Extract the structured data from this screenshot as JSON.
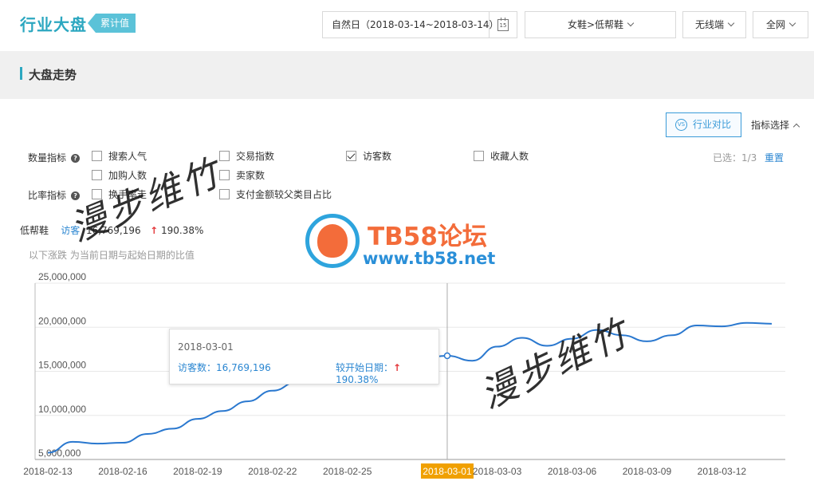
{
  "header": {
    "title": "行业大盘",
    "badge": "累计值",
    "date_range": "自然日（2018-03-14~2018-03-14）",
    "calendar_day": "15",
    "category": "女鞋>低帮鞋",
    "device": "无线端",
    "network": "全网"
  },
  "section": {
    "title": "大盘走势"
  },
  "toolbar": {
    "vs_icon_text": "VS",
    "compare_label": "行业对比",
    "metric_select_label": "指标选择"
  },
  "metrics": {
    "quantity_label": "数量指标",
    "rate_label": "比率指标",
    "help_glyph": "?",
    "items": [
      {
        "label": "搜索人气",
        "checked": false
      },
      {
        "label": "交易指数",
        "checked": false
      },
      {
        "label": "访客数",
        "checked": true
      },
      {
        "label": "收藏人数",
        "checked": false
      },
      {
        "label": "加购人数",
        "checked": false
      },
      {
        "label": "卖家数",
        "checked": false
      },
      {
        "label": "换手率走",
        "checked": false
      },
      {
        "label": "支付金额较父类目占比",
        "checked": false
      }
    ],
    "selected_info": "已选：1/3",
    "reset_label": "重置"
  },
  "summary": {
    "category": "低帮鞋",
    "metric": "访客",
    "value": "16,769,196",
    "change_arrow": "↑",
    "change": "190.38%",
    "note": "以下涨跌  为当前日期与起始日期的比值"
  },
  "tooltip": {
    "date": "2018-03-01",
    "value_label": "访客数：",
    "value": "16,769,196",
    "compare_label": "较开始日期：",
    "compare_arrow": "↑",
    "compare_value": "190.38%"
  },
  "watermark": {
    "title": "TB58论坛",
    "url": "www.tb58.net",
    "signature": "漫步维竹"
  },
  "chart_data": {
    "type": "line",
    "series": [
      {
        "name": "访客数",
        "color": "#2a78cf",
        "x": [
          "2018-02-13",
          "2018-02-14",
          "2018-02-15",
          "2018-02-16",
          "2018-02-17",
          "2018-02-18",
          "2018-02-19",
          "2018-02-20",
          "2018-02-21",
          "2018-02-22",
          "2018-02-23",
          "2018-02-24",
          "2018-02-25",
          "2018-02-26",
          "2018-02-27",
          "2018-02-28",
          "2018-03-01",
          "2018-03-02",
          "2018-03-03",
          "2018-03-04",
          "2018-03-05",
          "2018-03-06",
          "2018-03-07",
          "2018-03-08",
          "2018-03-09",
          "2018-03-10",
          "2018-03-11",
          "2018-03-12",
          "2018-03-13",
          "2018-03-14"
        ],
        "values": [
          5770000,
          7000000,
          6800000,
          6900000,
          7900000,
          8500000,
          9600000,
          10500000,
          11600000,
          12800000,
          13800000,
          14700000,
          15400000,
          15800000,
          16300000,
          16500000,
          16769196,
          16200000,
          17800000,
          18800000,
          17900000,
          18700000,
          19700000,
          19100000,
          18400000,
          19100000,
          20200000,
          20100000,
          20500000,
          20400000
        ]
      }
    ],
    "ylim": [
      5000000,
      25000000
    ],
    "yticks": [
      "5,000,000",
      "10,000,000",
      "15,000,000",
      "20,000,000",
      "25,000,000"
    ],
    "ytick_values": [
      5000000,
      10000000,
      15000000,
      20000000,
      25000000
    ],
    "xticks": [
      "2018-02-13",
      "2018-02-16",
      "2018-02-19",
      "2018-02-22",
      "2018-02-25",
      "2018-03-01",
      "2018-03-03",
      "2018-03-06",
      "2018-03-09",
      "2018-03-12"
    ],
    "xtick_index": [
      0,
      3,
      6,
      9,
      12,
      16,
      18,
      21,
      24,
      27
    ],
    "highlight_index": 16,
    "highlight_color": "#f0a000",
    "grid": true
  }
}
